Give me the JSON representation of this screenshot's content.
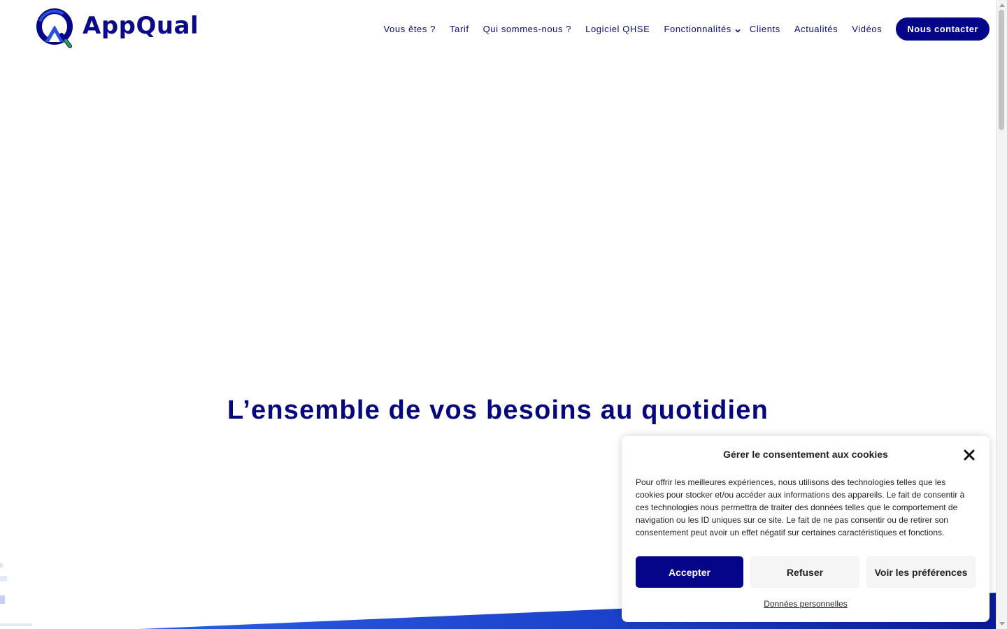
{
  "brand": {
    "name": "AppQual",
    "primary_color": "#05058a",
    "accent_color": "#2aa34a"
  },
  "nav": {
    "items": [
      {
        "label": "Vous êtes ?"
      },
      {
        "label": "Tarif"
      },
      {
        "label": "Qui sommes-nous ?"
      },
      {
        "label": "Logiciel QHSE"
      },
      {
        "label": "Fonctionnalités",
        "icon": "chevron-down-icon"
      },
      {
        "label": "Clients"
      },
      {
        "label": "Actualités"
      },
      {
        "label": "Vidéos"
      }
    ],
    "contact_label": "Nous contacter"
  },
  "hero": {
    "title": "L’ensemble de vos besoins au quotidien"
  },
  "cookie": {
    "title": "Gérer le consentement aux cookies",
    "close_icon": "close-icon",
    "text": "Pour offrir les meilleures expériences, nous utilisons des technologies telles que les cookies pour stocker et/ou accéder aux informations des appareils. Le fait de consentir à ces technologies nous permettra de traiter des données telles que le comportement de navigation ou les ID uniques sur ce site. Le fait de ne pas consentir ou de retirer son consentement peut avoir un effet négatif sur certaines caractéristiques et fonctions.",
    "accept_label": "Accepter",
    "refuse_label": "Refuser",
    "prefs_label": "Voir les préférences",
    "link_label": "Données personnelles"
  }
}
